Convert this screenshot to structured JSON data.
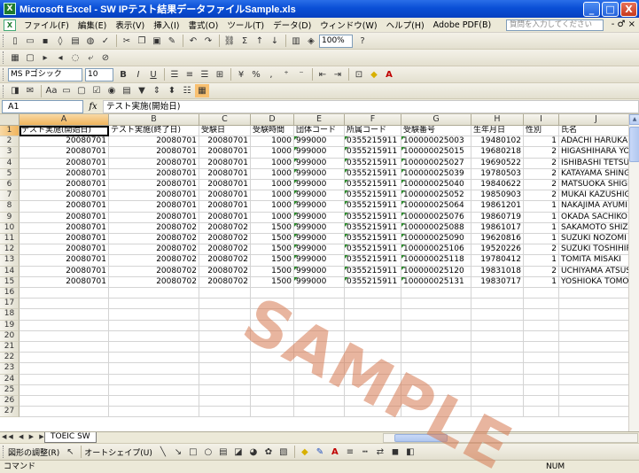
{
  "window": {
    "title": "Microsoft Excel - SW IPテスト結果データファイルSample.xls",
    "app_icon": "excel-icon",
    "controls": [
      "_",
      "□",
      "X"
    ]
  },
  "menu": {
    "items": [
      "ファイル(F)",
      "編集(E)",
      "表示(V)",
      "挿入(I)",
      "書式(O)",
      "ツール(T)",
      "データ(D)",
      "ウィンドウ(W)",
      "ヘルプ(H)",
      "Adobe PDF(B)"
    ],
    "help_placeholder": "質問を入力してください",
    "right_controls": "- ♂ ×"
  },
  "toolbar": {
    "zoom": "100%",
    "font_name": "MS Pゴシック",
    "font_size": "10",
    "bold": "B",
    "italic": "I",
    "underline": "U",
    "percent": "%",
    "sigma": "Σ"
  },
  "formula_bar": {
    "name_box": "A1",
    "fx": "fx",
    "content": "テスト実施(開始日)"
  },
  "columns": [
    "A",
    "B",
    "C",
    "D",
    "E",
    "F",
    "G",
    "H",
    "I",
    "J"
  ],
  "rows": [
    {
      "num": "1",
      "cells": [
        "テスト実施(開始日)",
        "テスト実施(終了日)",
        "受験日",
        "受験時間",
        "団体コード",
        "所属コード",
        "受験番号",
        "生年月日",
        "性別",
        "氏名"
      ]
    },
    {
      "num": "2",
      "cells": [
        "20080701",
        "20080701",
        "20080701",
        "1000",
        "999000",
        "0355215911",
        "100000025003",
        "19480102",
        "1",
        "ADACHI HARUKA"
      ]
    },
    {
      "num": "3",
      "cells": [
        "20080701",
        "20080701",
        "20080701",
        "1000",
        "999000",
        "0355215911",
        "100000025015",
        "19680218",
        "2",
        "HIGASHIHARA YOS"
      ]
    },
    {
      "num": "4",
      "cells": [
        "20080701",
        "20080701",
        "20080701",
        "1000",
        "999000",
        "0355215911",
        "100000025027",
        "19690522",
        "2",
        "ISHIBASHI TETSUY"
      ]
    },
    {
      "num": "5",
      "cells": [
        "20080701",
        "20080701",
        "20080701",
        "1000",
        "999000",
        "0355215911",
        "100000025039",
        "19780503",
        "2",
        "KATAYAMA SHINGO"
      ]
    },
    {
      "num": "6",
      "cells": [
        "20080701",
        "20080701",
        "20080701",
        "1000",
        "999000",
        "0355215911",
        "100000025040",
        "19840622",
        "2",
        "MATSUOKA SHIGE"
      ]
    },
    {
      "num": "7",
      "cells": [
        "20080701",
        "20080701",
        "20080701",
        "1000",
        "999000",
        "0355215911",
        "100000025052",
        "19850903",
        "2",
        "MUKAI KAZUSHIGE"
      ]
    },
    {
      "num": "8",
      "cells": [
        "20080701",
        "20080701",
        "20080701",
        "1000",
        "999000",
        "0355215911",
        "100000025064",
        "19861201",
        "1",
        "NAKAJIMA AYUMI"
      ]
    },
    {
      "num": "9",
      "cells": [
        "20080701",
        "20080701",
        "20080701",
        "1000",
        "999000",
        "0355215911",
        "100000025076",
        "19860719",
        "1",
        "OKADA SACHIKO"
      ]
    },
    {
      "num": "10",
      "cells": [
        "20080701",
        "20080702",
        "20080702",
        "1500",
        "999000",
        "0355215911",
        "100000025088",
        "19861017",
        "1",
        "SAKAMOTO SHIZU"
      ]
    },
    {
      "num": "11",
      "cells": [
        "20080701",
        "20080702",
        "20080702",
        "1500",
        "999000",
        "0355215911",
        "100000025090",
        "19620816",
        "1",
        "SUZUKI NOZOMI"
      ]
    },
    {
      "num": "12",
      "cells": [
        "20080701",
        "20080702",
        "20080702",
        "1500",
        "999000",
        "0355215911",
        "100000025106",
        "19520226",
        "2",
        "SUZUKI TOSHIHIRO"
      ]
    },
    {
      "num": "13",
      "cells": [
        "20080701",
        "20080702",
        "20080702",
        "1500",
        "999000",
        "0355215911",
        "100000025118",
        "19780412",
        "1",
        "TOMITA MISAKI"
      ]
    },
    {
      "num": "14",
      "cells": [
        "20080701",
        "20080702",
        "20080702",
        "1500",
        "999000",
        "0355215911",
        "100000025120",
        "19831018",
        "2",
        "UCHIYAMA ATSUSH"
      ]
    },
    {
      "num": "15",
      "cells": [
        "20080701",
        "20080702",
        "20080702",
        "1500",
        "999000",
        "0355215911",
        "100000025131",
        "19830717",
        "1",
        "YOSHIOKA TOMOK"
      ]
    },
    {
      "num": "16",
      "cells": []
    },
    {
      "num": "17",
      "cells": []
    },
    {
      "num": "18",
      "cells": []
    },
    {
      "num": "19",
      "cells": []
    },
    {
      "num": "20",
      "cells": []
    },
    {
      "num": "21",
      "cells": []
    },
    {
      "num": "22",
      "cells": []
    },
    {
      "num": "23",
      "cells": []
    },
    {
      "num": "24",
      "cells": []
    },
    {
      "num": "25",
      "cells": []
    },
    {
      "num": "26",
      "cells": []
    },
    {
      "num": "27",
      "cells": []
    }
  ],
  "sheet_tabs": [
    "TOEIC SW"
  ],
  "drawing_toolbar": {
    "draw_label": "図形の調整(R)",
    "autoshape_label": "オートシェイプ(U)"
  },
  "status": {
    "mode": "コマンド",
    "num_lock": "NUM"
  },
  "watermark": "SAMPLE"
}
